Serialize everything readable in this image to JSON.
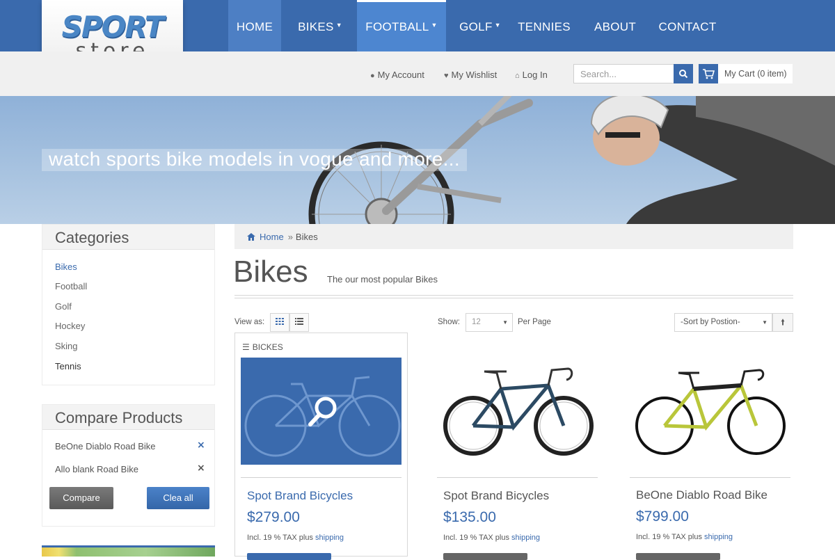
{
  "logo": {
    "word1": "SPORT",
    "word2": "store"
  },
  "nav": {
    "items": [
      {
        "label": "HOME",
        "caret": ""
      },
      {
        "label": "BIKES",
        "caret": "▼"
      },
      {
        "label": "FOOTBALL",
        "caret": "▼"
      },
      {
        "label": "GOLF",
        "caret": "▼"
      },
      {
        "label": "TENNIES",
        "caret": ""
      },
      {
        "label": "ABOUT",
        "caret": ""
      },
      {
        "label": "CONTACT",
        "caret": ""
      }
    ],
    "active_index": 0,
    "hover_index": 2
  },
  "utility": {
    "account": "My Account",
    "wishlist": "My Wishlist",
    "login": "Log In",
    "search_placeholder": "Search...",
    "cart": "My Cart (0 item)"
  },
  "banner": {
    "tagline": "watch sports bike models in vogue and more..."
  },
  "sidebar": {
    "categories_title": "Categories",
    "categories": [
      {
        "label": "Bikes",
        "active": true
      },
      {
        "label": "Football",
        "active": false
      },
      {
        "label": "Golf",
        "active": false
      },
      {
        "label": "Hockey",
        "active": false
      },
      {
        "label": "Sking",
        "active": false
      },
      {
        "label": "Tennis",
        "active": false
      }
    ],
    "compare_title": "Compare Products",
    "compare_items": [
      {
        "label": "BeOne Diablo Road Bike",
        "remove": "×"
      },
      {
        "label": "Allo blank Road Bike",
        "remove": "×"
      }
    ],
    "compare_button": "Compare",
    "clear_button": "Clea all"
  },
  "breadcrumb": {
    "home": "Home",
    "separator": "»",
    "current": "Bikes"
  },
  "page": {
    "title": "Bikes",
    "subtitle": "The our most popular Bikes"
  },
  "toolbar": {
    "view_as_label": "View as:",
    "show_label": "Show:",
    "show_value": "12",
    "per_page_label": "Per Page",
    "sort_value": "-Sort by Postion-"
  },
  "products": [
    {
      "category": "BICKES",
      "name": "Spot Brand Bicycles",
      "price": "$279.00",
      "tax": "Incl. 19 % TAX plus",
      "shipping": "shipping"
    },
    {
      "name": "Spot Brand Bicycles",
      "price": "$135.00",
      "tax": "Incl. 19 % TAX plus",
      "shipping": "shipping"
    },
    {
      "name": "BeOne Diablo Road Bike",
      "price": "$799.00",
      "tax": "Incl. 19 % TAX plus",
      "shipping": "shipping"
    }
  ],
  "colors": {
    "brand_blue": "#3a6aad",
    "nav_active": "#4d7fc4",
    "panel_grey": "#f0f0f0",
    "text": "#555555"
  }
}
